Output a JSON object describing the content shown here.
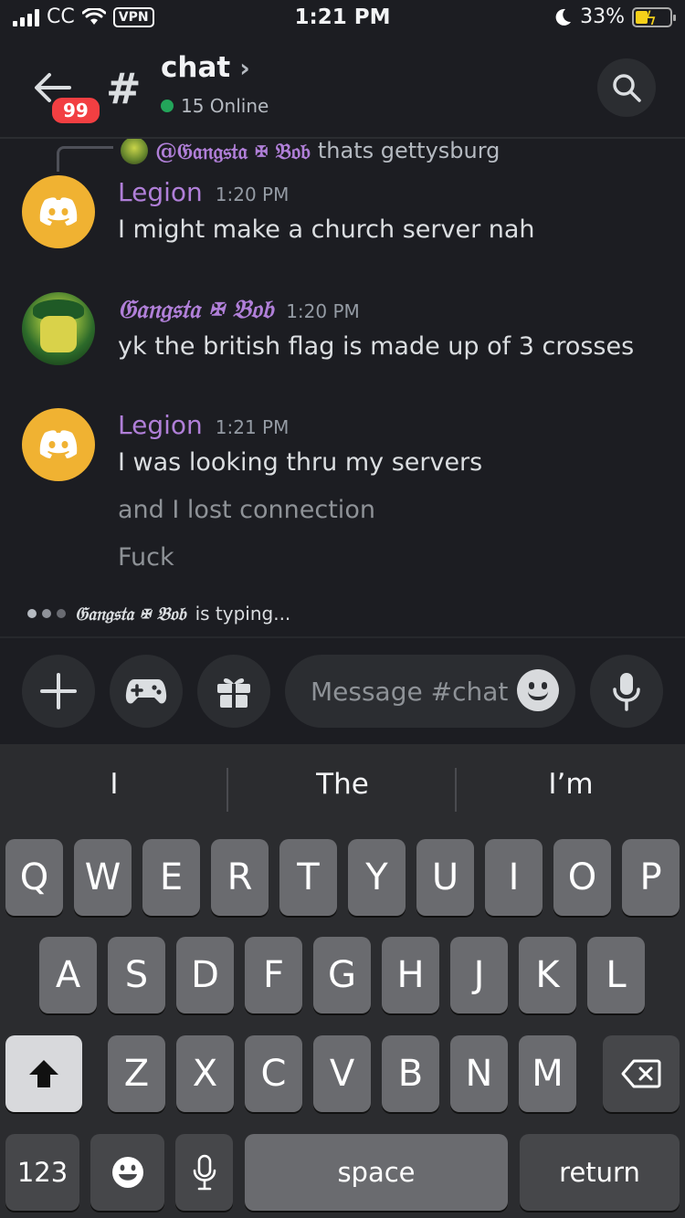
{
  "status_bar": {
    "carrier": "CC",
    "vpn": "VPN",
    "time": "1:21 PM",
    "battery": "33%"
  },
  "header": {
    "unread_badge": "99",
    "channel_name": "chat",
    "online": "15 Online"
  },
  "reply_preview": {
    "mention": "@𝔊𝔞𝔫𝔤𝔰𝔱𝔞 ✠ 𝔅𝔬𝔟",
    "text": "thats gettysburg"
  },
  "messages": [
    {
      "author": "Legion",
      "time": "1:20 PM",
      "lines": [
        "I might make a church server nah"
      ]
    },
    {
      "author": "𝔊𝔞𝔫𝔤𝔰𝔱𝔞 ✠ 𝔅𝔬𝔟",
      "time": "1:20 PM",
      "lines": [
        "yk the british flag is made up of 3 crosses"
      ]
    },
    {
      "author": "Legion",
      "time": "1:21 PM",
      "lines": [
        "I was looking thru my servers",
        "and I lost connection",
        "Fuck"
      ]
    }
  ],
  "typing": {
    "who": "𝔊𝔞𝔫𝔤𝔰𝔱𝔞 ✠ 𝔅𝔬𝔟",
    "suffix": "is typing..."
  },
  "composer": {
    "placeholder": "Message #chat"
  },
  "keyboard": {
    "suggestions": [
      "I",
      "The",
      "I’m"
    ],
    "row1": [
      "Q",
      "W",
      "E",
      "R",
      "T",
      "Y",
      "U",
      "I",
      "O",
      "P"
    ],
    "row2": [
      "A",
      "S",
      "D",
      "F",
      "G",
      "H",
      "J",
      "K",
      "L"
    ],
    "row3": [
      "Z",
      "X",
      "C",
      "V",
      "B",
      "N",
      "M"
    ],
    "numbers_key": "123",
    "space_key": "space",
    "return_key": "return"
  },
  "colors": {
    "background": "#1c1d22",
    "username_purple": "#b07fd8",
    "discord_avatar": "#f0b232",
    "badge_red": "#f23f42",
    "online_green": "#23a55a"
  },
  "icons": [
    "back-arrow-icon",
    "hash-icon",
    "chevron-right-icon",
    "search-icon",
    "discord-logo-icon",
    "plus-icon",
    "gamepad-icon",
    "gift-icon",
    "emoji-icon",
    "microphone-icon",
    "shift-icon",
    "backspace-icon"
  ]
}
